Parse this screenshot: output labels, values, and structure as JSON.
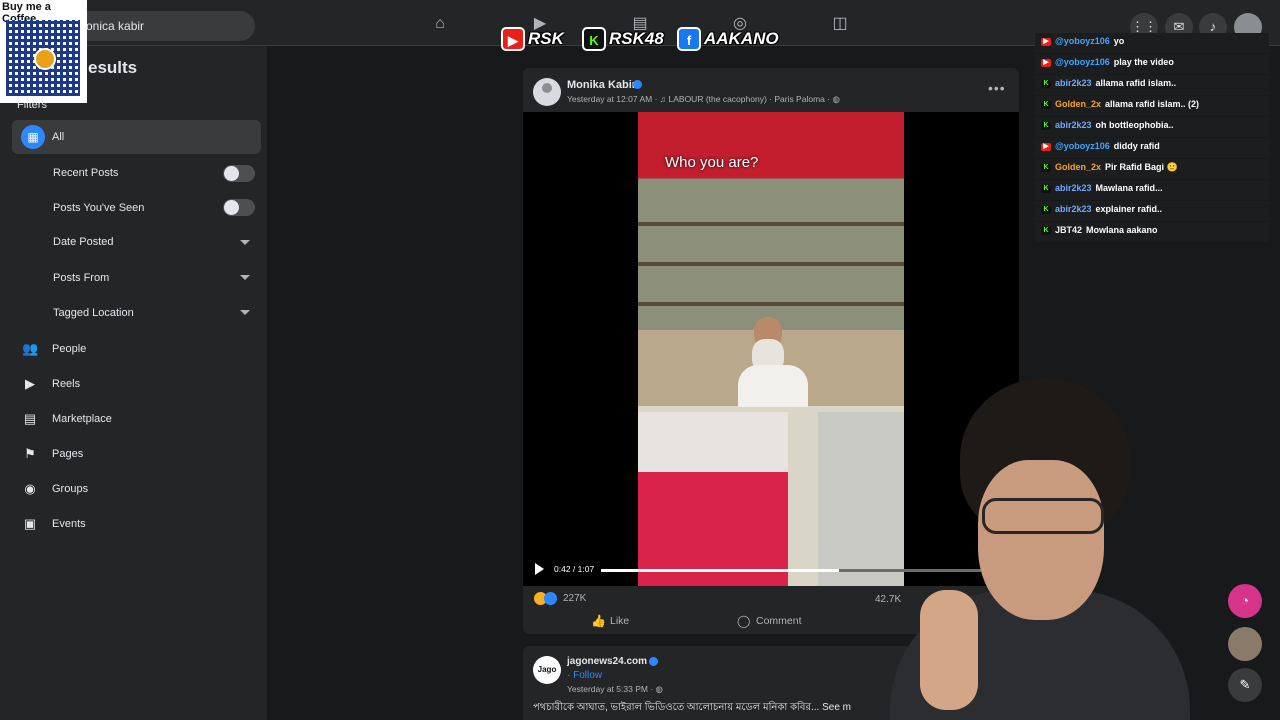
{
  "overlay": {
    "coffee_title": "Buy me a Coffee",
    "banner": [
      {
        "icon": "youtube-icon",
        "label": "RSK",
        "color": "#e62117"
      },
      {
        "icon": "kick-icon",
        "label": "RSK48",
        "color": "#53fc18"
      },
      {
        "icon": "facebook-icon",
        "label": "AAKANO",
        "color": "#1877f2"
      }
    ]
  },
  "topbar": {
    "search_value": "onica kabir",
    "nav_icons": [
      "home-icon",
      "watch-icon",
      "marketplace-icon",
      "groups-icon",
      "gaming-icon"
    ],
    "right_icons": [
      "apps-grid-icon",
      "messenger-icon",
      "notifications-icon",
      "profile-avatar"
    ]
  },
  "sidebar": {
    "title": "esults",
    "filters_label": "Filters",
    "all_label": "All",
    "toggles": [
      {
        "label": "Recent Posts",
        "on": false
      },
      {
        "label": "Posts You've Seen",
        "on": false
      }
    ],
    "dropdowns": [
      {
        "label": "Date Posted"
      },
      {
        "label": "Posts From"
      },
      {
        "label": "Tagged Location"
      }
    ],
    "nav": [
      {
        "label": "People",
        "icon": "people-icon"
      },
      {
        "label": "Reels",
        "icon": "reels-icon"
      },
      {
        "label": "Marketplace",
        "icon": "marketplace-icon"
      },
      {
        "label": "Pages",
        "icon": "pages-flag-icon"
      },
      {
        "label": "Groups",
        "icon": "groups-icon"
      },
      {
        "label": "Events",
        "icon": "events-icon"
      }
    ]
  },
  "post": {
    "author": "Monika Kabir",
    "meta": "Yesterday at 12:07 AM · ♫ LABOUR (the cacophony) · Paris Paloma · ",
    "video_caption": "Who you are?",
    "video_time": "0:42 / 1:07",
    "video_progress": 0.627,
    "reactions_count": "227K",
    "comments_count": "42.7K",
    "like_label": "Like",
    "comment_label": "Comment"
  },
  "post2": {
    "author": "jagonews24.com",
    "logo_text": "Jago",
    "follow_label": "· Follow",
    "meta": "Yesterday at 5:33 PM · ",
    "text": "পথচারীকে আঘাত, ভাইরাল ভিডিওতে আলোচনায় মডেল মনিকা কবির... See m"
  },
  "chat": [
    {
      "source": "youtube",
      "user": "@yoboyz106",
      "user_color": "#3ea6ff",
      "message": "yo"
    },
    {
      "source": "youtube",
      "user": "@yoboyz106",
      "user_color": "#3ea6ff",
      "message": "play the video"
    },
    {
      "source": "kick",
      "user": "abir2k23",
      "user_color": "#6fa8ff",
      "message": "allama rafid islam.."
    },
    {
      "source": "kick",
      "user": "Golden_2x",
      "user_color": "#f5a623",
      "message": "allama rafid islam.. (2)"
    },
    {
      "source": "kick",
      "user": "abir2k23",
      "user_color": "#6fa8ff",
      "message": "oh bottleophobia.."
    },
    {
      "source": "youtube",
      "user": "@yoboyz106",
      "user_color": "#3ea6ff",
      "message": "diddy rafid"
    },
    {
      "source": "kick",
      "user": "Golden_2x",
      "user_color": "#f5a623",
      "message": "Pir Rafid Bagi 🙂"
    },
    {
      "source": "kick",
      "user": "abir2k23",
      "user_color": "#6fa8ff",
      "message": "Mawlana rafid..."
    },
    {
      "source": "kick",
      "user": "abir2k23",
      "user_color": "#6fa8ff",
      "message": "explainer rafid.."
    },
    {
      "source": "kick",
      "user": "JBT42",
      "user_color": "#f5f5f5",
      "message": "Mowlana aakano"
    }
  ],
  "fabs": [
    "meta-ai-icon",
    "contact-avatar",
    "new-message-icon"
  ],
  "colors": {
    "accent": "#2d88ff",
    "bg": "#18191a",
    "panel": "#242526"
  }
}
